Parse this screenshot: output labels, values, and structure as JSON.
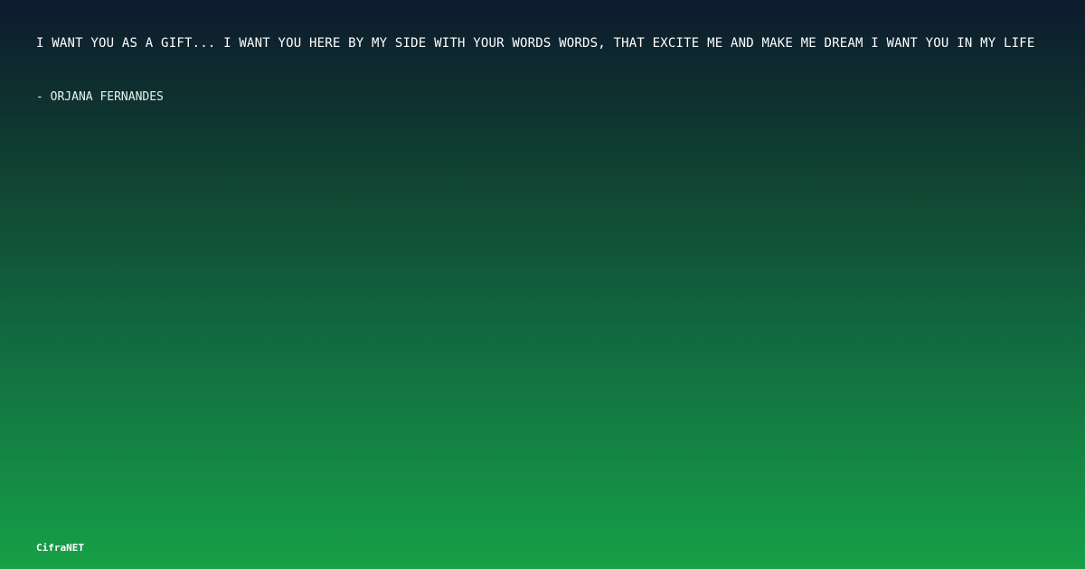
{
  "quote": {
    "text": "I WANT YOU AS A GIFT... I WANT YOU HERE BY MY SIDE WITH YOUR WORDS WORDS, THAT EXCITE ME AND MAKE ME DREAM I WANT YOU IN MY LIFE",
    "author": "- ORJANA FERNANDES"
  },
  "brand": {
    "name": "CifraNET"
  },
  "colors": {
    "background_top": "#0e1a2e",
    "background_bottom": "#16a047",
    "text": "#ffffff"
  }
}
